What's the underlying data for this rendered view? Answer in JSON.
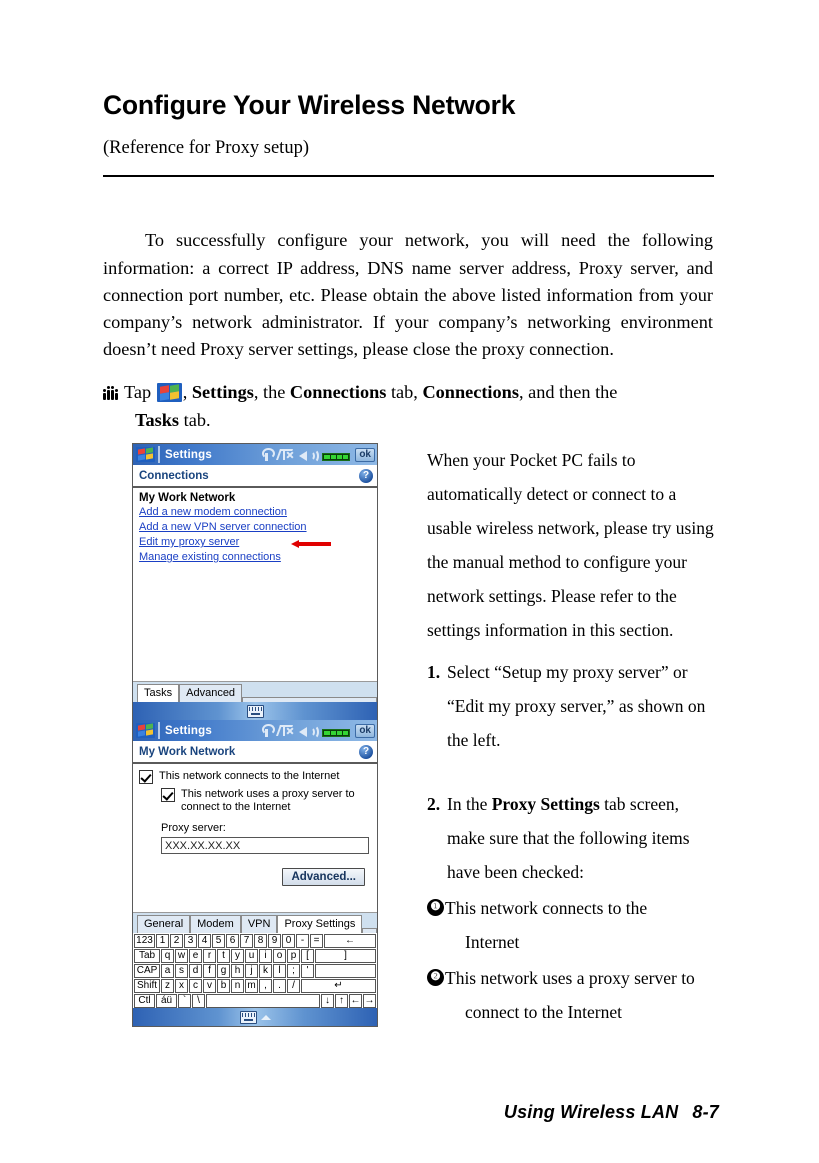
{
  "document": {
    "title": "Configure Your Wireless Network",
    "subtitle": "(Reference for Proxy setup)",
    "intro": "To successfully configure your network, you will need the following information: a correct IP address, DNS name server address, Proxy server, and connection port number, etc. Please obtain the above listed information from your company’s network administrator. If your company’s networking environment doesn’t need Proxy server settings, please close the proxy connection.",
    "tap_line": {
      "lead": "Tap",
      "after_icon_1": ", ",
      "settings": "Settings",
      "mid_1": ", the ",
      "connections_tab": "Connections",
      "mid_2": " tab, ",
      "connections": "Connections",
      "mid_3": ", and then the",
      "second_line_bold": "Tasks",
      "second_line_rest": " tab."
    },
    "footer": {
      "chapter": "Using Wireless LAN",
      "page": "8-7"
    }
  },
  "screen1": {
    "titlebar": {
      "title": "Settings",
      "ok_label": "ok",
      "icons": [
        "antenna-icon",
        "signal-x-icon",
        "speaker-icon",
        "battery-icon"
      ]
    },
    "subheader": {
      "title": "Connections",
      "help_label": "?"
    },
    "group_title": "My Work Network",
    "links": [
      "Add a new modem connection",
      "Add a new VPN server connection",
      "Edit my proxy server",
      "Manage existing connections"
    ],
    "arrow_target_index": 2,
    "tabs": [
      {
        "label": "Tasks",
        "selected": true
      },
      {
        "label": "Advanced",
        "selected": false
      }
    ]
  },
  "screen2": {
    "titlebar": {
      "title": "Settings",
      "ok_label": "ok"
    },
    "subheader": {
      "title": "My Work Network",
      "help_label": "?"
    },
    "checkboxes": [
      {
        "label": "This network connects to the Internet",
        "checked": true,
        "indent": false
      },
      {
        "label": "This network uses a proxy server to connect to the Internet",
        "checked": true,
        "indent": true
      }
    ],
    "proxy_label": "Proxy server:",
    "proxy_value": "XXX.XX.XX.XX",
    "advanced_button": "Advanced...",
    "tabs": [
      {
        "label": "General",
        "selected": false
      },
      {
        "label": "Modem",
        "selected": false
      },
      {
        "label": "VPN",
        "selected": false
      },
      {
        "label": "Proxy Settings",
        "selected": true
      }
    ]
  },
  "keyboard": {
    "row1": [
      "123",
      "1",
      "2",
      "3",
      "4",
      "5",
      "6",
      "7",
      "8",
      "9",
      "0",
      "-",
      "=",
      "←"
    ],
    "row2": [
      "Tab",
      "q",
      "w",
      "e",
      "r",
      "t",
      "y",
      "u",
      "i",
      "o",
      "p",
      "[",
      "]"
    ],
    "row3": [
      "CAP",
      "a",
      "s",
      "d",
      "f",
      "g",
      "h",
      "j",
      "k",
      "l",
      ";",
      "'"
    ],
    "row4": [
      "Shift",
      "z",
      "x",
      "c",
      "v",
      "b",
      "n",
      "m",
      ",",
      ".",
      "/",
      "↵"
    ],
    "row5": [
      "Ctl",
      "áü",
      "`",
      "\\",
      "",
      "↓",
      "↑",
      "←",
      "→"
    ]
  },
  "right_column": {
    "paragraph": "When your Pocket PC fails to automatically detect or connect to a usable wireless network, please try using the manual method to configure your network settings. Please refer to the settings information in this section.",
    "steps": [
      {
        "num": "1.",
        "text": "Select “Setup my proxy server” or “Edit my proxy server,” as shown on the left."
      }
    ],
    "step2": {
      "num": "2.",
      "pre": "In the ",
      "bold": "Proxy Settings",
      "post": " tab screen, make sure that the following items have been checked:"
    },
    "bullets": [
      {
        "num": "❶",
        "line1": "This network connects to the",
        "line2": "Internet"
      },
      {
        "num": "❷",
        "line1": "This network uses a proxy server to",
        "line2": "connect to the Internet"
      }
    ]
  },
  "colors": {
    "link": "#1a3fc4",
    "header_blue": "#19447e",
    "arrow_red": "#e00000",
    "titlebar_blue": "#2e62b4"
  }
}
